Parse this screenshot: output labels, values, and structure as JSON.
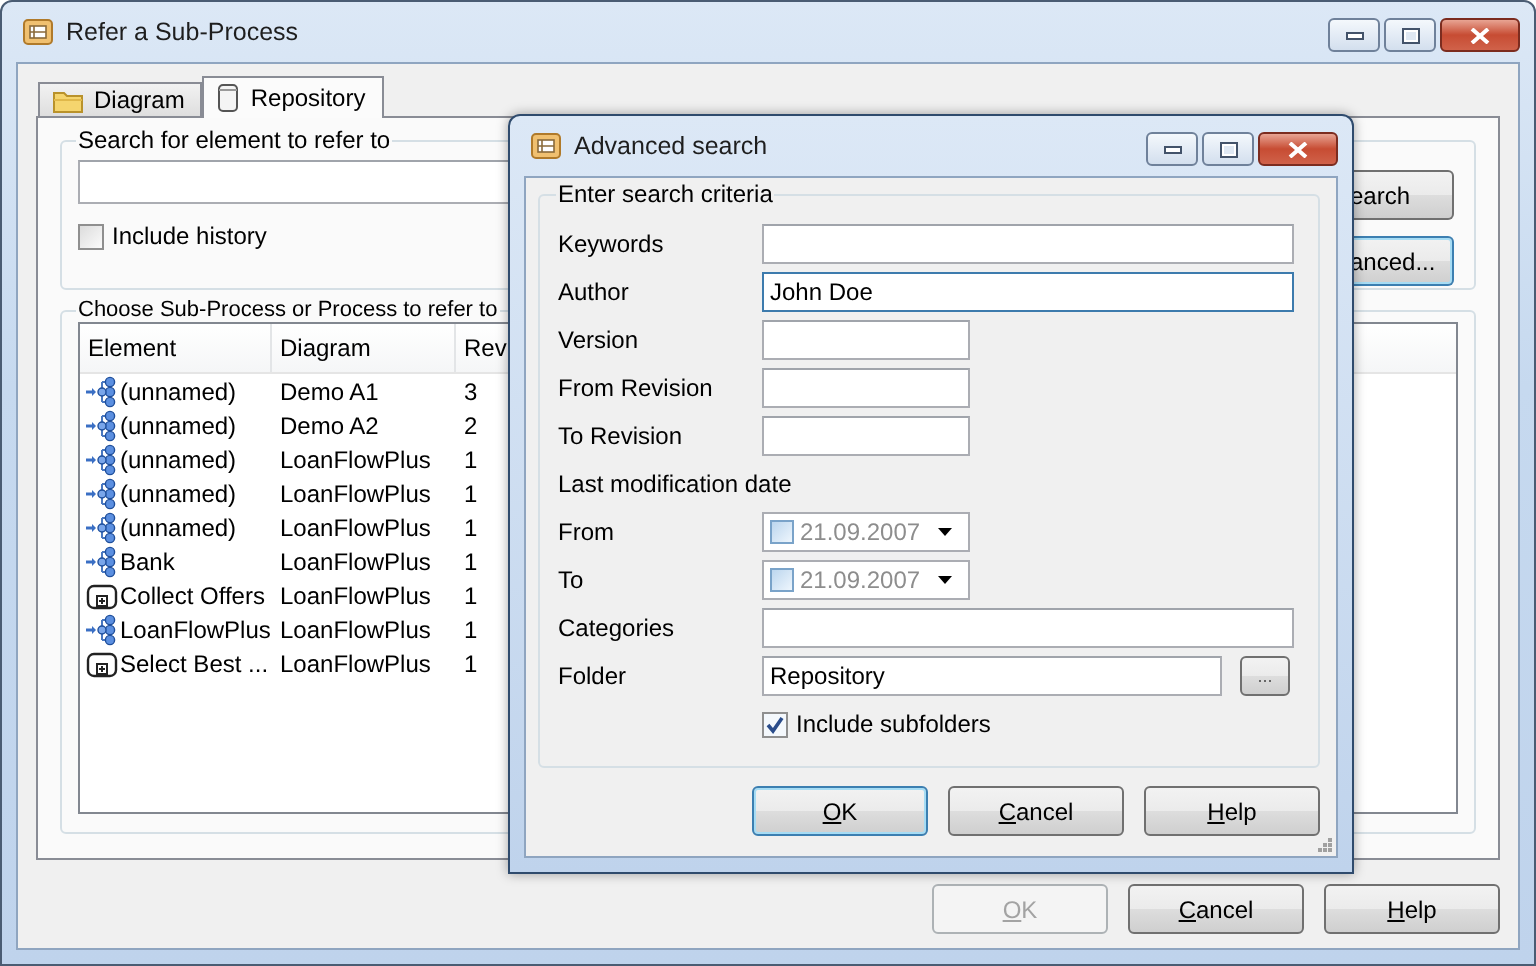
{
  "window": {
    "title": "Refer a Sub-Process"
  },
  "tabs": [
    {
      "label": "Diagram",
      "selected": false
    },
    {
      "label": "Repository",
      "selected": true
    }
  ],
  "search_group": {
    "title": "Search for element to refer to",
    "include_history": {
      "label": "Include history",
      "checked": false
    },
    "buttons": [
      {
        "label": "earch",
        "focused": false
      },
      {
        "label": "anced...",
        "focused": true
      }
    ]
  },
  "list_group": {
    "title": "Choose Sub-Process or Process to refer to",
    "columns": [
      "Element",
      "Diagram",
      "Rev"
    ],
    "rows": [
      {
        "kind": "process",
        "cells": [
          "(unnamed)",
          "Demo A1",
          "3"
        ]
      },
      {
        "kind": "process",
        "cells": [
          "(unnamed)",
          "Demo A2",
          "2"
        ]
      },
      {
        "kind": "process",
        "cells": [
          "(unnamed)",
          "LoanFlowPlus",
          "1"
        ]
      },
      {
        "kind": "process",
        "cells": [
          "(unnamed)",
          "LoanFlowPlus",
          "1"
        ]
      },
      {
        "kind": "process",
        "cells": [
          "(unnamed)",
          "LoanFlowPlus",
          "1"
        ]
      },
      {
        "kind": "process",
        "cells": [
          "Bank",
          "LoanFlowPlus",
          "1"
        ]
      },
      {
        "kind": "subprocess",
        "cells": [
          "Collect Offers",
          "LoanFlowPlus",
          "1"
        ]
      },
      {
        "kind": "process",
        "cells": [
          "LoanFlowPlus",
          "LoanFlowPlus",
          "1"
        ]
      },
      {
        "kind": "subprocess",
        "cells": [
          "Select Best ...",
          "LoanFlowPlus",
          "1"
        ]
      }
    ]
  },
  "buttons": [
    {
      "label": "OK",
      "disabled": true
    },
    {
      "label": "Cancel",
      "disabled": false
    },
    {
      "label": "Help",
      "disabled": false
    }
  ],
  "dialog": {
    "title": "Advanced search",
    "group_title": "Enter search criteria",
    "fields": [
      {
        "kind": "text",
        "label": "Keywords",
        "focused": false
      },
      {
        "kind": "text",
        "label": "Author",
        "value": "John Doe",
        "focused": true
      },
      {
        "kind": "number",
        "label": "Version",
        "focused": false
      },
      {
        "kind": "number",
        "label": "From Revision",
        "focused": false
      },
      {
        "kind": "number",
        "label": "To Revision",
        "focused": false
      },
      {
        "kind": "heading",
        "label": "Last modification date"
      },
      {
        "kind": "date",
        "label": "From",
        "value": "21.09.2007",
        "checked": false
      },
      {
        "kind": "date",
        "label": "To",
        "value": "21.09.2007",
        "checked": false
      },
      {
        "kind": "text",
        "label": "Categories",
        "focused": false
      },
      {
        "kind": "folder",
        "label": "Folder",
        "value": "Repository",
        "browse": "..."
      },
      {
        "kind": "checkbox",
        "label": "Include subfolders",
        "checked": true
      }
    ],
    "buttons": [
      {
        "label": "OK",
        "focused": true
      },
      {
        "label": "Cancel",
        "focused": false
      },
      {
        "label": "Help",
        "focused": false
      }
    ]
  }
}
